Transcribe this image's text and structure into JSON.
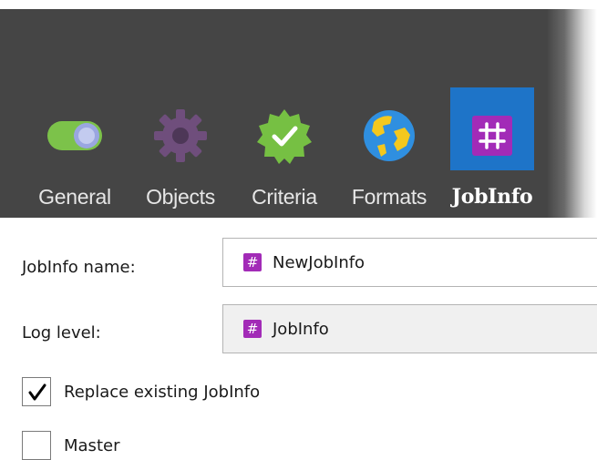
{
  "tabs": [
    {
      "label": "General",
      "icon": "toggle-icon",
      "active": false
    },
    {
      "label": "Objects",
      "icon": "gear-icon",
      "active": false
    },
    {
      "label": "Criteria",
      "icon": "check-badge-icon",
      "active": false
    },
    {
      "label": "Formats",
      "icon": "globe-icon",
      "active": false
    },
    {
      "label": "JobInfo",
      "icon": "hash-icon",
      "active": true
    }
  ],
  "form": {
    "name_label": "JobInfo name:",
    "name_value": "NewJobInfo",
    "log_label": "Log level:",
    "log_value": "JobInfo",
    "replace_label": "Replace existing JobInfo",
    "replace_checked": true,
    "master_label": "Master",
    "master_checked": false
  },
  "colors": {
    "toolbar_bg": "#454545",
    "active_tab_bg": "#1e74c8",
    "jobinfo_purple": "#a22bb7",
    "criteria_green": "#76c043",
    "objects_purple": "#6f4e7c",
    "toggle_green": "#7cc24a",
    "toggle_knob": "#9aa6e0",
    "globe_blue": "#2f8fe0",
    "globe_land": "#f4c81e"
  }
}
